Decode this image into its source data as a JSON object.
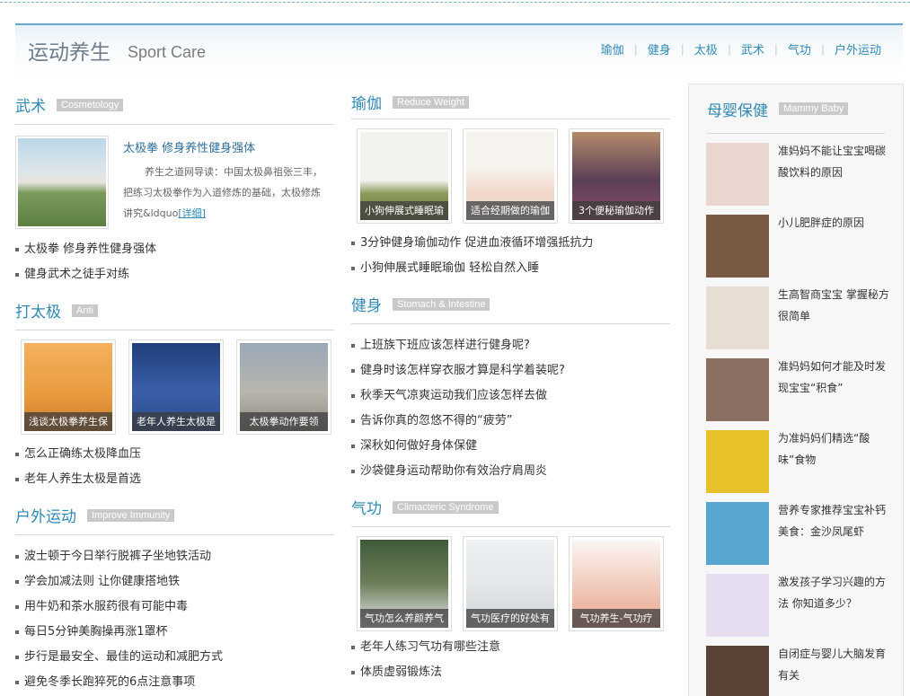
{
  "header": {
    "brand_cn": "运动养生",
    "brand_en": "Sport Care",
    "nav": [
      "瑜伽",
      "健身",
      "太极",
      "武术",
      "气功",
      "户外运动"
    ]
  },
  "left": {
    "wushu": {
      "title": "武术",
      "tag": "Cosmetology",
      "feature": {
        "title": "太极拳 修身养性健身强体",
        "desc": "养生之道网导读：中国太极鼻祖张三丰，把练习太极拳作为入道修炼的基础，太极修炼讲究&ldquo",
        "more": "[详细]"
      },
      "items": [
        "太极拳 修身养性健身强体",
        "健身武术之徒手对练"
      ]
    },
    "taiji": {
      "title": "打太极",
      "tag": "Anti",
      "thumbs": [
        "浅谈太极拳养生保",
        "老年人养生太极是",
        "太极拳动作要领"
      ],
      "items": [
        "怎么正确练太极降血压",
        "老年人养生太极是首选"
      ]
    },
    "outdoor": {
      "title": "户外运动",
      "tag": "Improve Immunity",
      "items": [
        "波士顿于今日举行脱裤子坐地铁活动",
        "学会加减法则 让你健康搭地铁",
        "用牛奶和茶水服药很有可能中毒",
        "每日5分钟美胸操再涨1罩杯",
        "步行是最安全、最佳的运动和减肥方式",
        "避免冬季长跑猝死的6点注意事项"
      ]
    }
  },
  "middle": {
    "yoga": {
      "title": "瑜伽",
      "tag": "Reduce Weight",
      "thumbs": [
        "小狗伸展式睡眠瑜",
        "适合经期做的瑜伽",
        "3个便秘瑜伽动作"
      ],
      "items": [
        "3分钟健身瑜伽动作 促进血液循环增强抵抗力",
        "小狗伸展式睡眠瑜伽 轻松自然入睡"
      ]
    },
    "fitness": {
      "title": "健身",
      "tag": "Stomach & Intestine",
      "items": [
        "上班族下班应该怎样进行健身呢?",
        "健身时该怎样穿衣服才算是科学着装呢?",
        "秋季天气凉爽运动我们应该怎样去做",
        "告诉你真的忽悠不得的“疲劳”",
        "深秋如何做好身体保健",
        "沙袋健身运动帮助你有效治疗肩周炎"
      ]
    },
    "qigong": {
      "title": "气功",
      "tag": "Climacteric Syndrome",
      "thumbs": [
        "气功怎么养颜养气",
        "气功医疗的好处有",
        "气功养生-气功疗"
      ],
      "items": [
        "老年人练习气功有哪些注意",
        "体质虚弱锻炼法"
      ]
    }
  },
  "right": {
    "title": "母婴保健",
    "tag": "Mammy Baby",
    "items": [
      {
        "text": "准妈妈不能让宝宝喝碳酸饮料的原因",
        "color": "#e9d6cf"
      },
      {
        "text": "小儿肥胖症的原因",
        "color": "#7a5a42"
      },
      {
        "text": "生高智商宝宝 掌握秘方很简单",
        "color": "#e8ddd2"
      },
      {
        "text": "准妈妈如何才能及时发现宝宝“积食”",
        "color": "#8a6f62"
      },
      {
        "text": "为准妈妈们精选“酸味”食物",
        "color": "#e6c12a"
      },
      {
        "text": "营养专家推荐宝宝补钙美食：金沙凤尾虾",
        "color": "#57a5d1"
      },
      {
        "text": "激发孩子学习兴趣的方法 你知道多少？",
        "color": "#e6ddf0"
      },
      {
        "text": "自闭症与婴儿大脑发育有关",
        "color": "#5a4236"
      }
    ]
  }
}
